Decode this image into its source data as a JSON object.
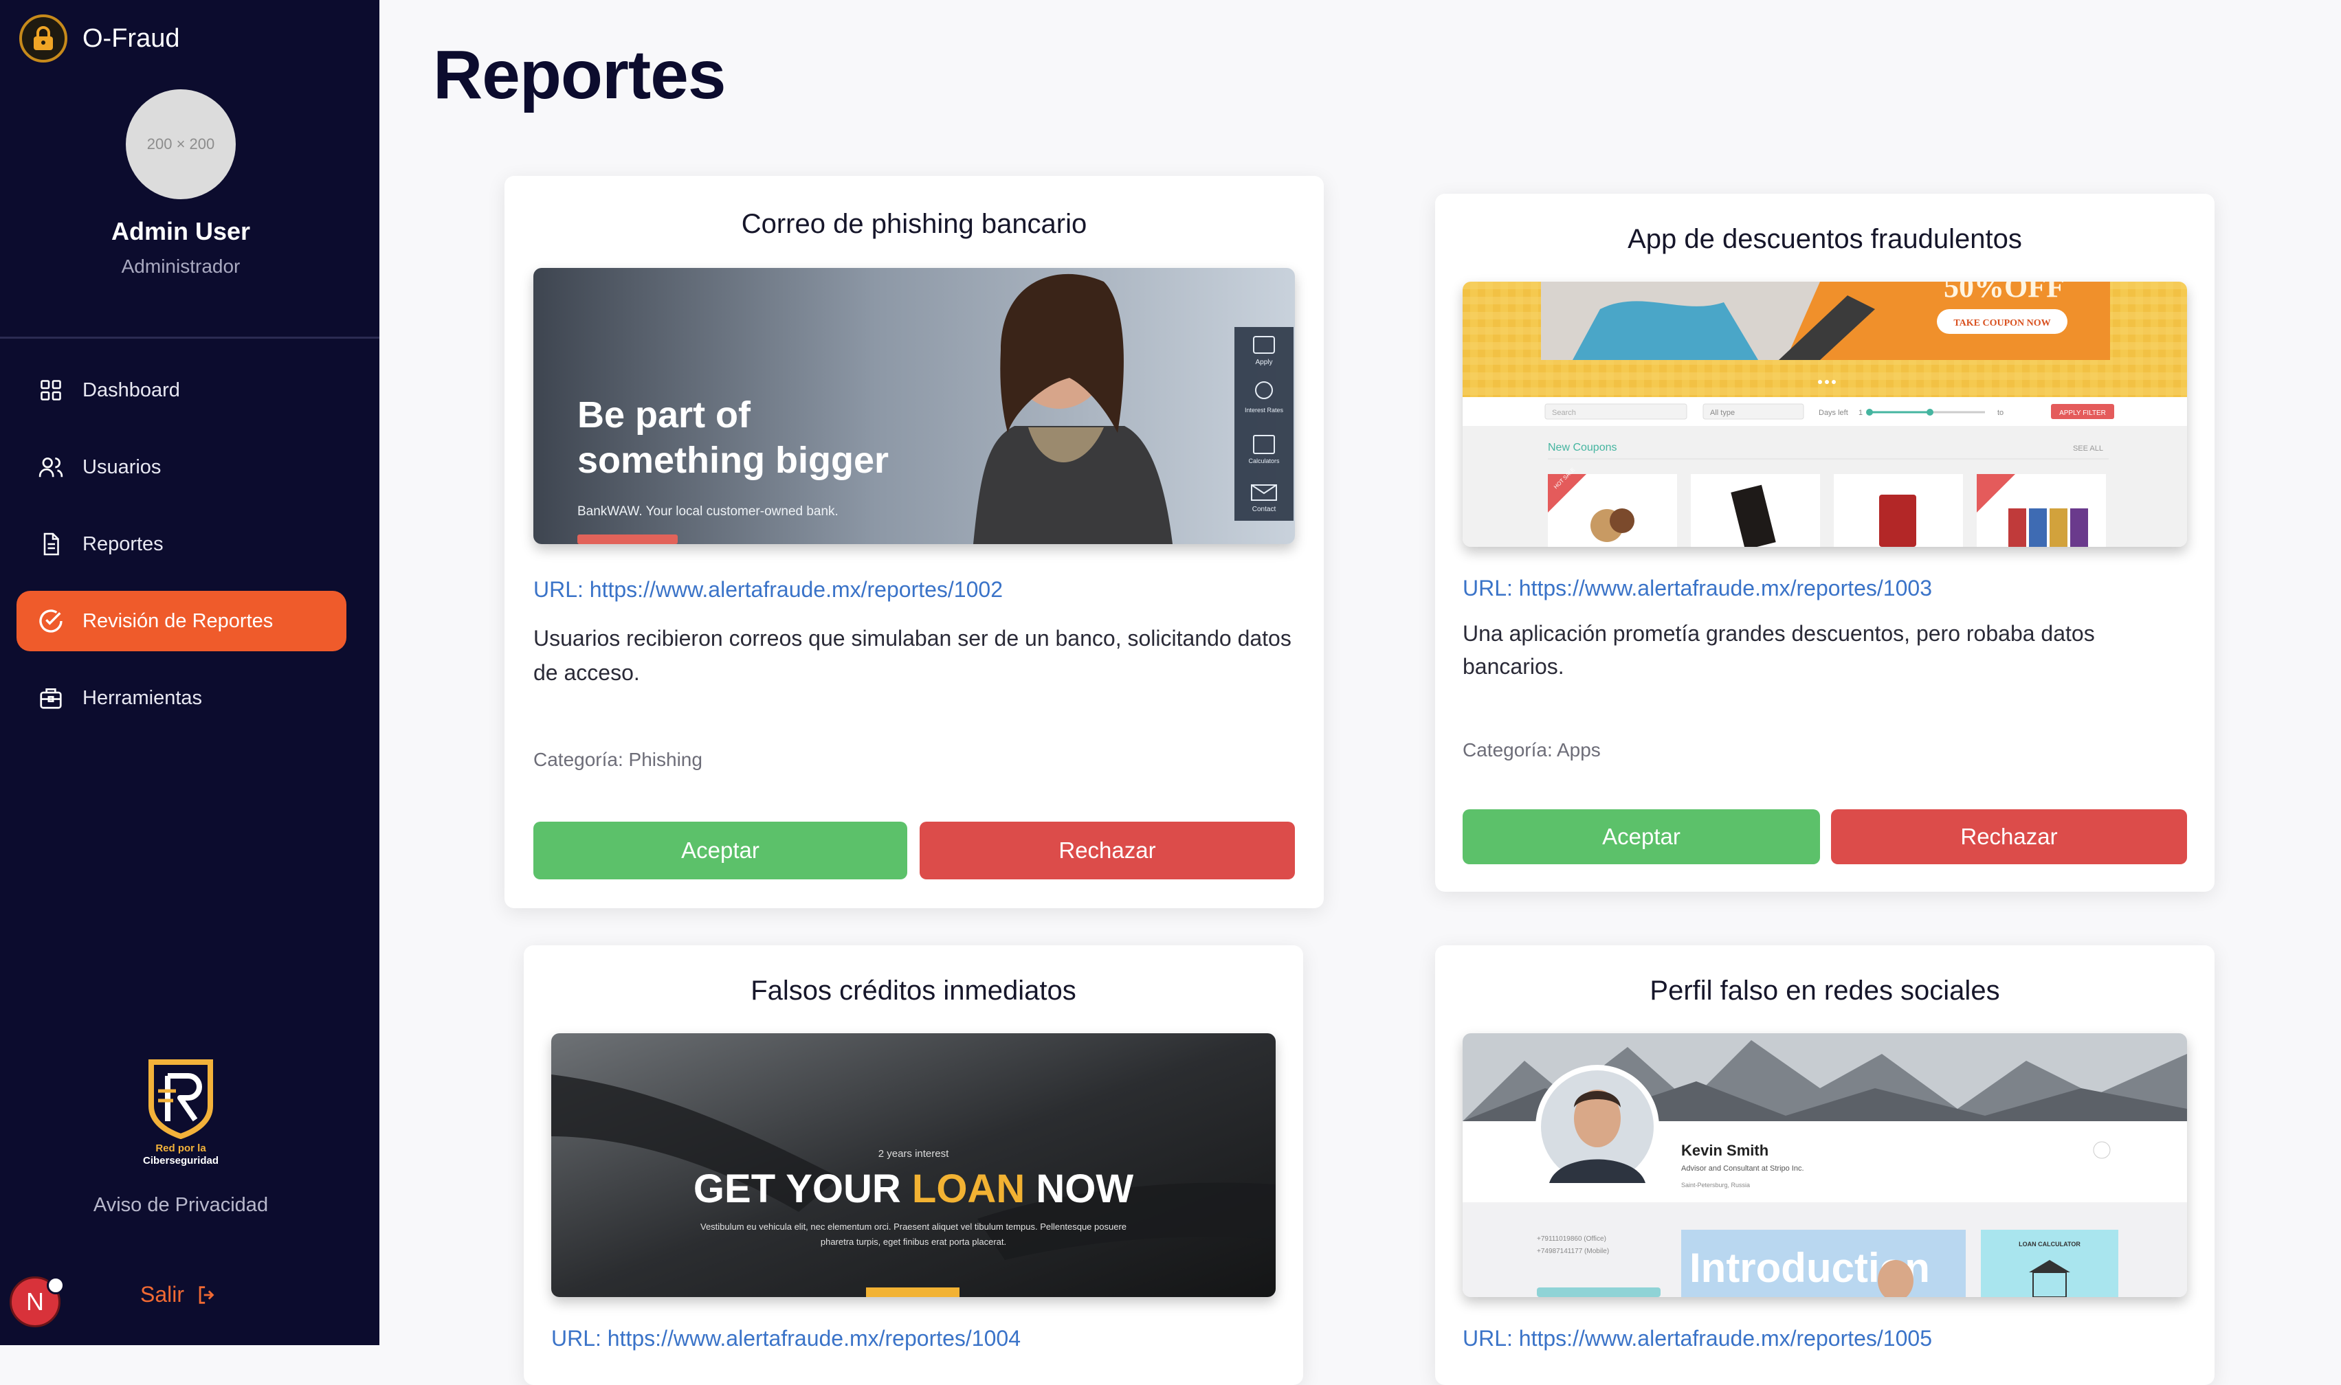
{
  "app": {
    "name": "O-Fraud"
  },
  "user": {
    "avatar_placeholder": "200 × 200",
    "name": "Admin User",
    "role": "Administrador"
  },
  "nav": [
    {
      "label": "Dashboard",
      "icon": "grid-icon",
      "active": false
    },
    {
      "label": "Usuarios",
      "icon": "users-icon",
      "active": false
    },
    {
      "label": "Reportes",
      "icon": "document-icon",
      "active": false
    },
    {
      "label": "Revisión de Reportes",
      "icon": "check-circle-icon",
      "active": true
    },
    {
      "label": "Herramientas",
      "icon": "toolbox-icon",
      "active": false
    }
  ],
  "footer": {
    "org_line1": "Red por la",
    "org_line2": "Ciberseguridad",
    "privacy": "Aviso de Privacidad",
    "logout": "Salir",
    "badge_letter": "N"
  },
  "page": {
    "title": "Reportes"
  },
  "reports": [
    {
      "title": "Correo de phishing bancario",
      "url": "URL: https://www.alertafraude.mx/reportes/1002",
      "description": "Usuarios recibieron correos que simulaban ser de un banco, solicitando datos de acceso.",
      "category": "Categoría: Phishing",
      "image": {
        "headline1": "Be part of",
        "headline2": "something bigger",
        "tagline": "BankWAW. Your local customer-owned bank.",
        "side_items": [
          "Apply",
          "Interest Rates",
          "Calculators",
          "Contact"
        ]
      }
    },
    {
      "title": "App de descuentos fraudulentos",
      "url": "URL: https://www.alertafraude.mx/reportes/1003",
      "description": "Una aplicación prometía grandes descuentos, pero robaba datos bancarios.",
      "category": "Categoría: Apps",
      "image": {
        "banner_text": "50%OFF",
        "coupon_button": "TAKE COUPON NOW",
        "search": "Search",
        "filter_type": "All type",
        "days_left": "Days left",
        "range_from": "1",
        "range_to": "to",
        "apply_filter": "APPLY FILTER",
        "section": "New Coupons",
        "see_all": "SEE ALL",
        "hot_badge": "HOT SALE"
      }
    },
    {
      "title": "Falsos créditos inmediatos",
      "url": "URL: https://www.alertafraude.mx/reportes/1004",
      "image": {
        "kicker": "2 years interest",
        "headline_a": "GET YOUR ",
        "headline_b": "LOAN",
        "headline_c": " NOW",
        "body1": "Vestibulum eu vehicula elit, nec elementum orci. Praesent aliquet vel tibulum tempus. Pellentesque posuere",
        "body2": "pharetra turpis, eget finibus erat porta placerat."
      }
    },
    {
      "title": "Perfil falso en redes sociales",
      "url": "URL: https://www.alertafraude.mx/reportes/1005",
      "image": {
        "name": "Kevin Smith",
        "subtitle": "Advisor and Consultant at Stripo Inc.",
        "location": "Saint-Petersburg, Russia",
        "phone1": "+79111019860 (Office)",
        "phone2": "+74987141177 (Mobile)",
        "intro": "Introduction",
        "widget": "LOAN CALCULATOR"
      }
    }
  ],
  "buttons": {
    "accept": "Aceptar",
    "reject": "Rechazar"
  }
}
